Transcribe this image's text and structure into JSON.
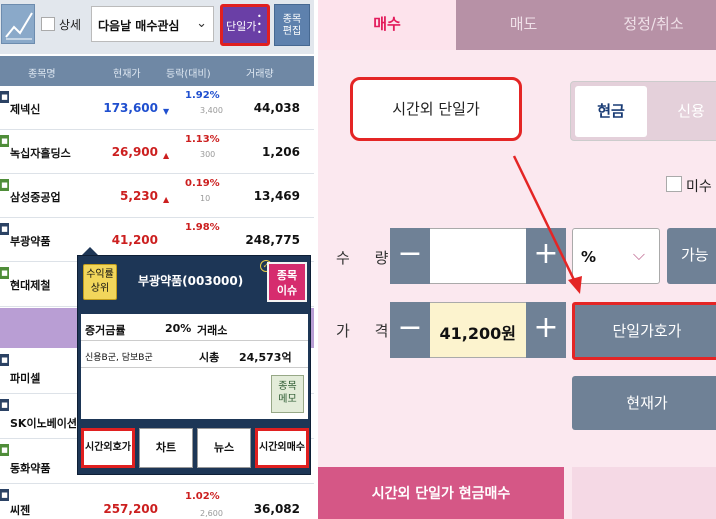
{
  "left": {
    "toolbar": {
      "detail_label": "상세",
      "group_label": "다음날 매수관심",
      "unit_price_label": "단일가",
      "edit_label_1": "종목",
      "edit_label_2": "편집"
    },
    "columns": [
      "종목명",
      "현재가",
      "등락(대비)",
      "거래량"
    ],
    "rows": [
      {
        "name": "제넥신",
        "price": "173,600",
        "pct": "1.92%",
        "chg": "3,400",
        "volume": "44,038",
        "dir": "dn"
      },
      {
        "name": "녹십자홀딩스",
        "price": "26,900",
        "pct": "1.13%",
        "chg": "300",
        "volume": "1,206",
        "dir": "up"
      },
      {
        "name": "삼성중공업",
        "price": "5,230",
        "pct": "0.19%",
        "chg": "10",
        "volume": "13,469",
        "dir": "up"
      },
      {
        "name": "부광약품",
        "price": "41,200",
        "pct": "1.98%",
        "chg": "",
        "volume": "248,775",
        "dir": "up"
      },
      {
        "name": "현대제철",
        "price": "",
        "pct": "",
        "chg": "",
        "volume": "",
        "dir": ""
      },
      {
        "name": "파미셀",
        "price": "",
        "pct": "",
        "chg": "",
        "volume": "",
        "dir": ""
      },
      {
        "name": "SK이노베이션",
        "price": "",
        "pct": "",
        "chg": "",
        "volume": "",
        "dir": ""
      },
      {
        "name": "동화약품",
        "price": "",
        "pct": "",
        "chg": "",
        "volume": "",
        "dir": ""
      },
      {
        "name": "씨젠",
        "price": "257,200",
        "pct": "1.02%",
        "chg": "2,600",
        "volume": "36,082",
        "dir": "up"
      }
    ],
    "popup": {
      "tab_label_1": "수익률",
      "tab_label_2": "상위",
      "title": "부광약품(003000)",
      "issue_1": "종목",
      "issue_2": "이슈",
      "margin_label": "증거금률",
      "margin_value": "20%",
      "market": "거래소",
      "credit": "신용B군, 담보B군",
      "cap_label": "시총",
      "cap_value": "24,573억",
      "memo_1": "종목",
      "memo_2": "메모",
      "buttons": [
        "시간외호가",
        "차트",
        "뉴스",
        "시간외매수"
      ]
    }
  },
  "right": {
    "tabs": [
      "매수",
      "매도",
      "정정/취소"
    ],
    "session": "시간외 단일가",
    "seg_cash": "현금",
    "seg_credit": "신용",
    "unfilled_label": "미수",
    "qty_label": "수 량",
    "qty_minus": "−",
    "qty_plus": "+",
    "pct_value": "%",
    "avail_label": "가능",
    "price_label": "가 격",
    "price_minus": "−",
    "price_plus": "+",
    "price_value": "41,200원",
    "unit_quote_btn": "단일가호가",
    "current_price_btn": "현재가",
    "buy_btn": "시간외 단일가 현금매수"
  },
  "colors": {
    "up": "#cc1f1f",
    "down": "#1f4fcf",
    "accent_pink": "#e31c5c",
    "highlight_red": "#e42525",
    "button_slate": "#6f8196"
  }
}
